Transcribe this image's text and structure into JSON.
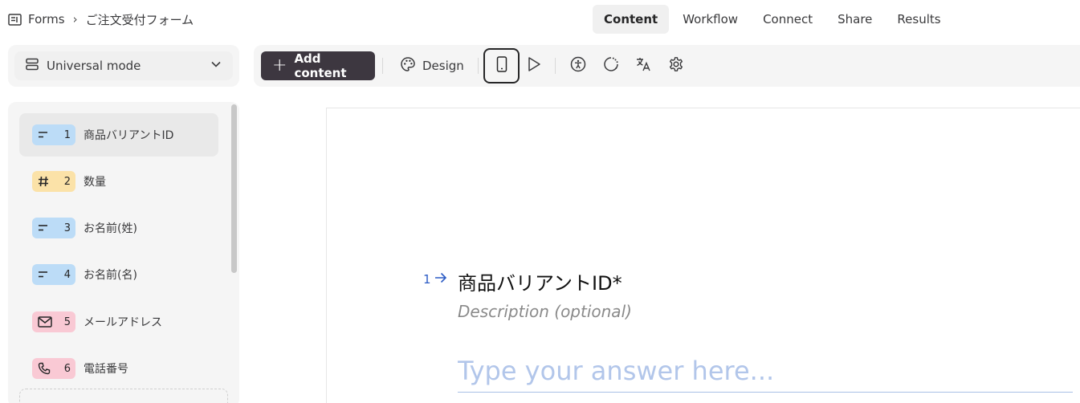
{
  "breadcrumb": {
    "root": "Forms",
    "separator": "›",
    "current": "ご注文受付フォーム"
  },
  "nav": {
    "tabs": [
      {
        "label": "Content"
      },
      {
        "label": "Workflow"
      },
      {
        "label": "Connect"
      },
      {
        "label": "Share"
      },
      {
        "label": "Results"
      }
    ],
    "active": "Content"
  },
  "mode": {
    "label": "Universal mode"
  },
  "questions": [
    {
      "number": "1",
      "label": "商品バリアントID",
      "icon": "short-text-icon",
      "color": "#bcdcf7",
      "selected": true
    },
    {
      "number": "2",
      "label": "数量",
      "icon": "hash-icon",
      "color": "#fbe2a8"
    },
    {
      "number": "3",
      "label": "お名前(姓)",
      "icon": "short-text-icon",
      "color": "#bcdcf7"
    },
    {
      "number": "4",
      "label": "お名前(名)",
      "icon": "short-text-icon",
      "color": "#bcdcf7"
    },
    {
      "number": "5",
      "label": "メールアドレス",
      "icon": "mail-icon",
      "color": "#f9c9d4"
    },
    {
      "number": "6",
      "label": "電話番号",
      "icon": "phone-icon",
      "color": "#f9c9d4"
    }
  ],
  "toolbar": {
    "add_label": "Add content",
    "design_label": "Design"
  },
  "canvas": {
    "question_number": "1",
    "title": "商品バリアントID*",
    "description": "Description (optional)",
    "answer_placeholder": "Type your answer here..."
  },
  "colors": {
    "accent": "#3d3740",
    "link_blue": "#2c5cc5",
    "panel_bg": "#f5f5f5"
  }
}
